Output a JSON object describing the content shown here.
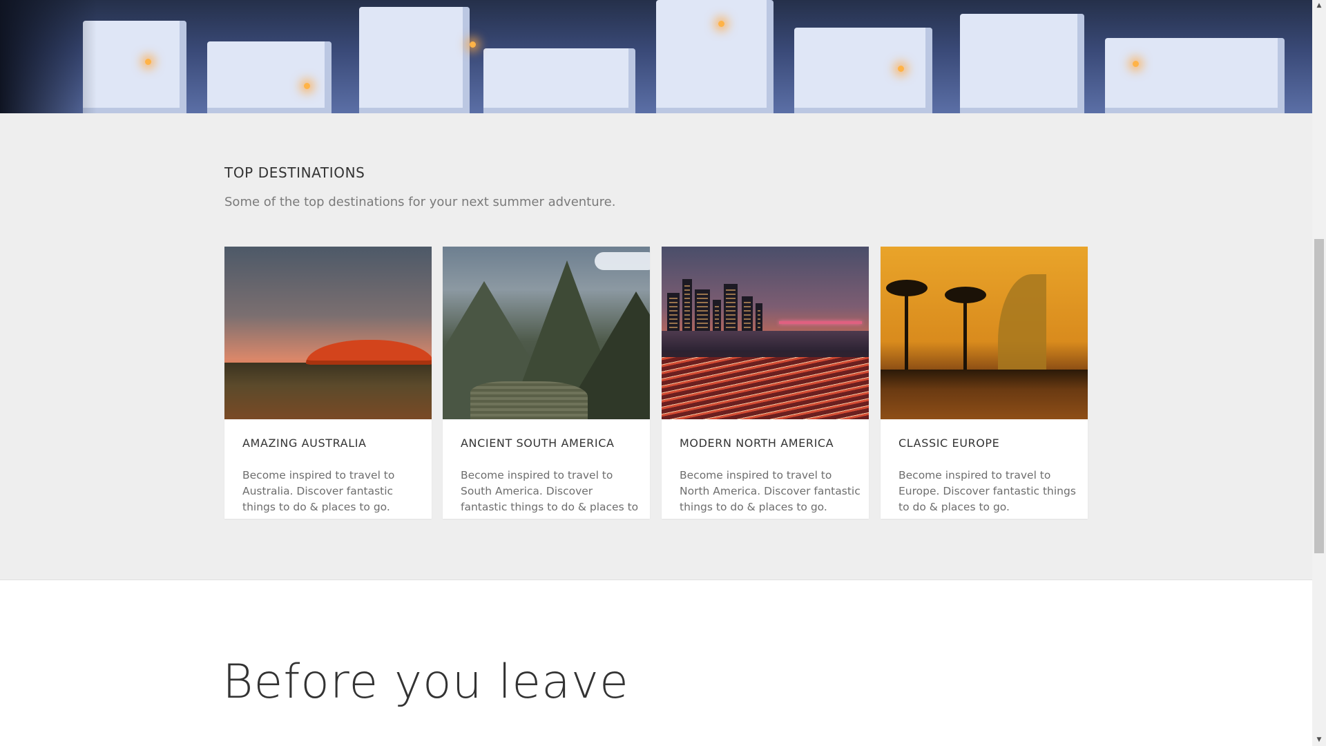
{
  "section": {
    "title": "TOP DESTINATIONS",
    "subtitle": "Some of the top destinations for your next summer adventure."
  },
  "cards": [
    {
      "title": "AMAZING AUSTRALIA",
      "text": "Become inspired to travel to Australia. Discover fantastic things to do & places to go."
    },
    {
      "title": "ANCIENT SOUTH AMERICA",
      "text": "Become inspired to travel to South America. Discover fantastic things to do & places to go."
    },
    {
      "title": "MODERN NORTH AMERICA",
      "text": "Become inspired to travel to North America. Discover fantastic things to do & places to go."
    },
    {
      "title": "CLASSIC EUROPE",
      "text": "Become inspired to travel to Europe. Discover fantastic things to do & places to go."
    }
  ],
  "before": {
    "title": "Before you leave"
  },
  "scrollbar": {
    "up_icon": "scroll-up-arrow-icon",
    "down_icon": "scroll-down-arrow-icon"
  },
  "colors": {
    "section_bg": "#eeeeee",
    "card_bg": "#ffffff",
    "heading": "#333333",
    "body_text": "#6d6d6d"
  }
}
